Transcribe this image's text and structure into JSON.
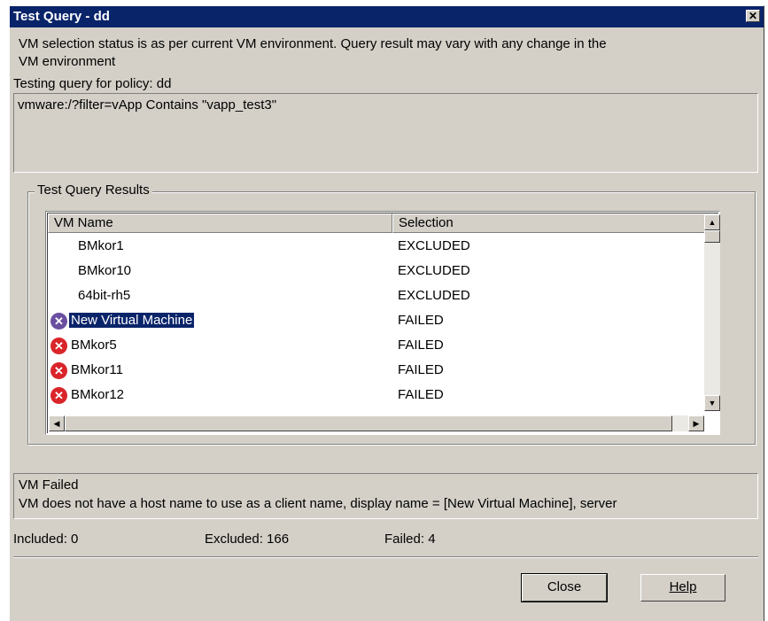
{
  "window": {
    "title": "Test Query - dd",
    "close_glyph": "✕"
  },
  "intro": {
    "line1": "VM selection status is as per current VM environment. Query result may vary with any change in the",
    "line2": "VM environment",
    "policy_label": "Testing query for policy: dd"
  },
  "query": {
    "text": "vmware:/?filter=vApp Contains \"vapp_test3\""
  },
  "results": {
    "group_label": "Test Query Results",
    "columns": [
      "VM Name",
      "Selection"
    ],
    "rows": [
      {
        "name": "BMkor1",
        "selection": "EXCLUDED",
        "icon": "",
        "selected": false
      },
      {
        "name": "BMkor10",
        "selection": "EXCLUDED",
        "icon": "",
        "selected": false
      },
      {
        "name": "64bit-rh5",
        "selection": "EXCLUDED",
        "icon": "",
        "selected": false
      },
      {
        "name": "New Virtual Machine",
        "selection": "FAILED",
        "icon": "error-icon",
        "selected": true
      },
      {
        "name": "BMkor5",
        "selection": "FAILED",
        "icon": "error-icon",
        "selected": false
      },
      {
        "name": "BMkor11",
        "selection": "FAILED",
        "icon": "error-icon",
        "selected": false
      },
      {
        "name": "BMkor12",
        "selection": "FAILED",
        "icon": "error-icon",
        "selected": false
      }
    ]
  },
  "detail": {
    "title": "VM Failed",
    "message": "VM does not have a host name to use as a client name, display name = [New Virtual Machine], server"
  },
  "summary": {
    "included": "Included: 0",
    "excluded": "Excluded: 166",
    "failed": "Failed: 4"
  },
  "buttons": {
    "close": "Close",
    "help": "Help"
  },
  "colors": {
    "titlebar": "#0a246a",
    "error": "#d9252a"
  }
}
